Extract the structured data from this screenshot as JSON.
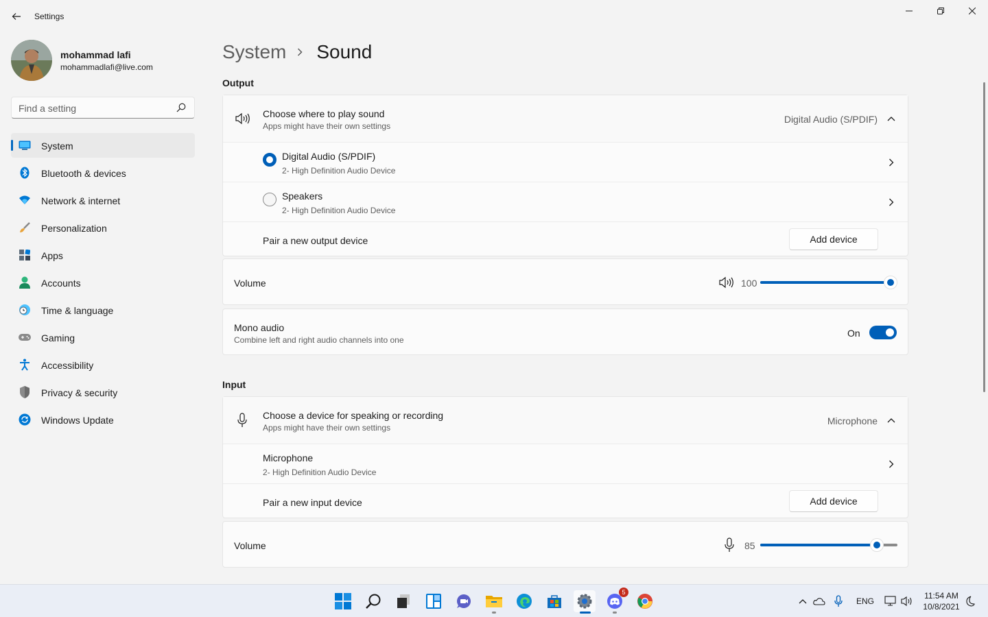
{
  "window": {
    "title": "Settings"
  },
  "profile": {
    "name": "mohammad lafi",
    "email": "mohammadlafi@live.com"
  },
  "search": {
    "placeholder": "Find a setting"
  },
  "nav": [
    {
      "label": "System",
      "icon": "system-icon",
      "active": true
    },
    {
      "label": "Bluetooth & devices",
      "icon": "bluetooth-icon"
    },
    {
      "label": "Network & internet",
      "icon": "wifi-icon"
    },
    {
      "label": "Personalization",
      "icon": "brush-icon"
    },
    {
      "label": "Apps",
      "icon": "apps-icon"
    },
    {
      "label": "Accounts",
      "icon": "person-icon"
    },
    {
      "label": "Time & language",
      "icon": "clock-globe-icon"
    },
    {
      "label": "Gaming",
      "icon": "gamepad-icon"
    },
    {
      "label": "Accessibility",
      "icon": "accessibility-icon"
    },
    {
      "label": "Privacy & security",
      "icon": "shield-icon"
    },
    {
      "label": "Windows Update",
      "icon": "update-icon"
    }
  ],
  "breadcrumb": {
    "parent": "System",
    "current": "Sound"
  },
  "output": {
    "section_title": "Output",
    "header": {
      "title": "Choose where to play sound",
      "subtitle": "Apps might have their own settings",
      "selected": "Digital Audio (S/PDIF)"
    },
    "devices": [
      {
        "name": "Digital Audio (S/PDIF)",
        "detail": "2- High Definition Audio Device",
        "selected": true
      },
      {
        "name": "Speakers",
        "detail": "2- High Definition Audio Device",
        "selected": false
      }
    ],
    "pair": {
      "label": "Pair a new output device",
      "button": "Add device"
    },
    "volume": {
      "label": "Volume",
      "value": "100",
      "level": 1.0
    },
    "mono": {
      "title": "Mono audio",
      "subtitle": "Combine left and right audio channels into one",
      "state": "On"
    }
  },
  "input": {
    "section_title": "Input",
    "header": {
      "title": "Choose a device for speaking or recording",
      "subtitle": "Apps might have their own settings",
      "selected": "Microphone"
    },
    "devices": [
      {
        "name": "Microphone",
        "detail": "2- High Definition Audio Device"
      }
    ],
    "pair": {
      "label": "Pair a new input device",
      "button": "Add device"
    },
    "volume": {
      "label": "Volume",
      "value": "85",
      "level": 0.85
    }
  },
  "taskbar": {
    "apps": [
      "start-icon",
      "search-icon",
      "task-view-icon",
      "widgets-icon",
      "chat-icon",
      "file-explorer-icon",
      "edge-icon",
      "store-icon",
      "settings-icon",
      "discord-icon",
      "chrome-icon"
    ],
    "discord_badge": "5",
    "language": "ENG",
    "time": "11:54 AM",
    "date": "10/8/2021"
  },
  "colors": {
    "accent": "#005fb8",
    "background": "#f3f3f3",
    "card": "#fbfbfb"
  }
}
